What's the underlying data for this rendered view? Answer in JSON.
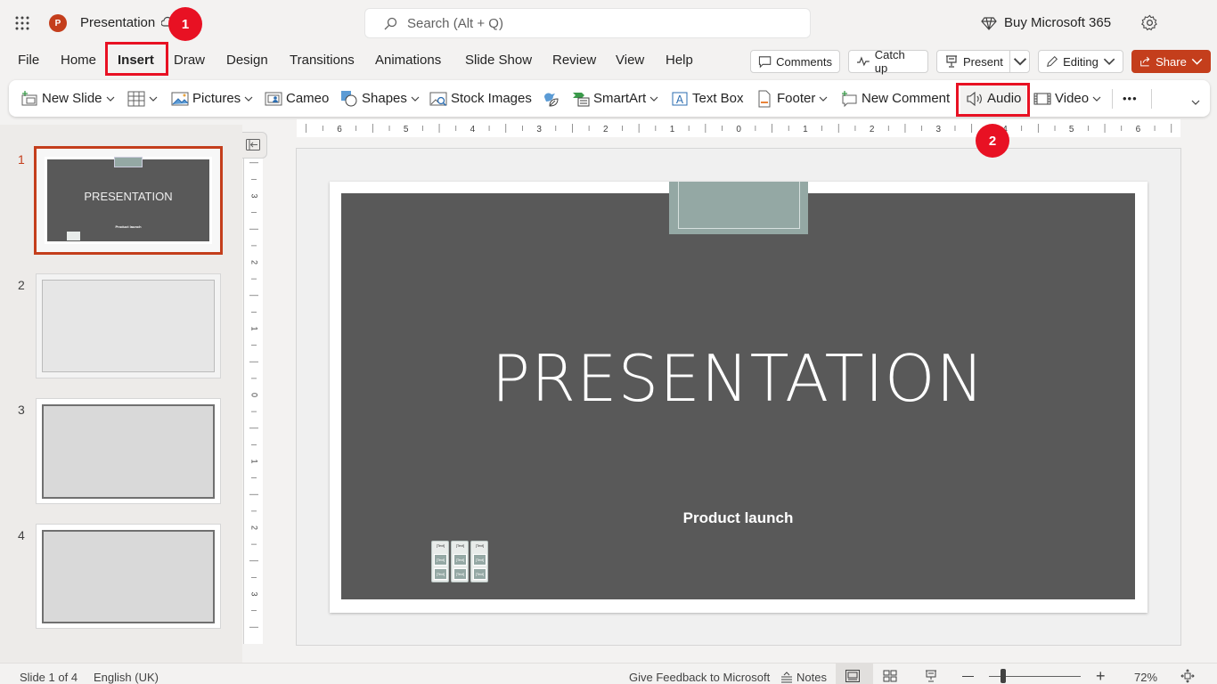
{
  "app": {
    "doc_title": "Presentation",
    "search_placeholder": "Search (Alt + Q)",
    "buy_label": "Buy Microsoft 365"
  },
  "menu": {
    "tabs": [
      "File",
      "Home",
      "Insert",
      "Draw",
      "Design",
      "Transitions",
      "Animations",
      "Slide Show",
      "Review",
      "View",
      "Help"
    ],
    "active_tab": "Insert"
  },
  "top_actions": {
    "comments": "Comments",
    "catch_up": "Catch up",
    "present": "Present",
    "editing": "Editing",
    "share": "Share"
  },
  "ribbon": {
    "new_slide": "New Slide",
    "pictures": "Pictures",
    "cameo": "Cameo",
    "shapes": "Shapes",
    "stock_images": "Stock Images",
    "smartart": "SmartArt",
    "text_box": "Text Box",
    "footer": "Footer",
    "new_comment": "New Comment",
    "audio": "Audio",
    "video": "Video",
    "more": "•••"
  },
  "badges": {
    "one": "1",
    "two": "2"
  },
  "thumbnails": [
    {
      "num": "1",
      "title": "PRESENTATION",
      "subtitle": "Product launch"
    },
    {
      "num": "2"
    },
    {
      "num": "3"
    },
    {
      "num": "4"
    }
  ],
  "ruler": {
    "h_labels": [
      "6",
      "5",
      "4",
      "3",
      "2",
      "1",
      "0",
      "1",
      "2",
      "3",
      "4",
      "5",
      "6"
    ],
    "v_labels": [
      "3",
      "2",
      "1",
      "0",
      "1",
      "2",
      "3"
    ]
  },
  "slide": {
    "title": "PRESENTATION",
    "subtitle": "Product launch",
    "mini_table_text": "[Text]"
  },
  "status": {
    "slide_info": "Slide 1 of 4",
    "language": "English (UK)",
    "feedback": "Give Feedback to Microsoft",
    "notes": "Notes",
    "zoom": "72%",
    "zoom_level_percent": 72
  },
  "colors": {
    "accent": "#c43e1c",
    "badge": "#e81123",
    "slide_bg": "#595959",
    "slide_shape": "#94a8a4"
  }
}
